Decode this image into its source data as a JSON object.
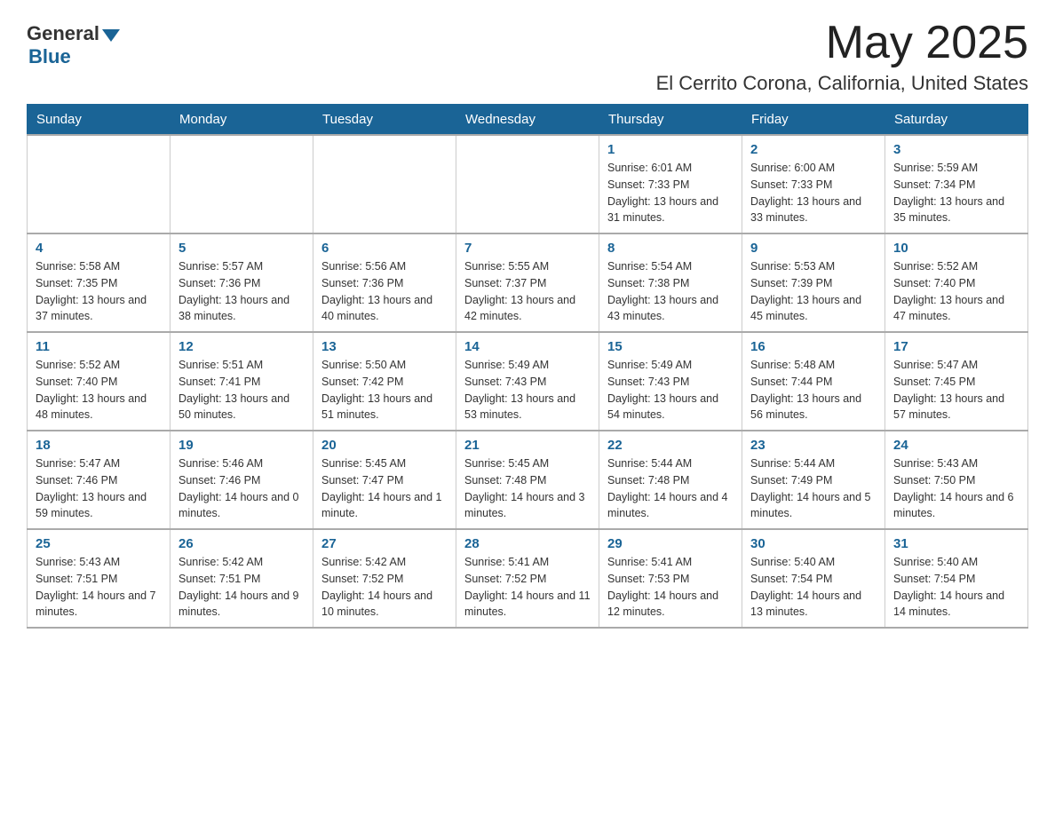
{
  "header": {
    "logo_general": "General",
    "logo_blue": "Blue",
    "month_title": "May 2025",
    "location": "El Cerrito Corona, California, United States"
  },
  "days_of_week": [
    "Sunday",
    "Monday",
    "Tuesday",
    "Wednesday",
    "Thursday",
    "Friday",
    "Saturday"
  ],
  "weeks": [
    [
      {
        "day": "",
        "sunrise": "",
        "sunset": "",
        "daylight": ""
      },
      {
        "day": "",
        "sunrise": "",
        "sunset": "",
        "daylight": ""
      },
      {
        "day": "",
        "sunrise": "",
        "sunset": "",
        "daylight": ""
      },
      {
        "day": "",
        "sunrise": "",
        "sunset": "",
        "daylight": ""
      },
      {
        "day": "1",
        "sunrise": "Sunrise: 6:01 AM",
        "sunset": "Sunset: 7:33 PM",
        "daylight": "Daylight: 13 hours and 31 minutes."
      },
      {
        "day": "2",
        "sunrise": "Sunrise: 6:00 AM",
        "sunset": "Sunset: 7:33 PM",
        "daylight": "Daylight: 13 hours and 33 minutes."
      },
      {
        "day": "3",
        "sunrise": "Sunrise: 5:59 AM",
        "sunset": "Sunset: 7:34 PM",
        "daylight": "Daylight: 13 hours and 35 minutes."
      }
    ],
    [
      {
        "day": "4",
        "sunrise": "Sunrise: 5:58 AM",
        "sunset": "Sunset: 7:35 PM",
        "daylight": "Daylight: 13 hours and 37 minutes."
      },
      {
        "day": "5",
        "sunrise": "Sunrise: 5:57 AM",
        "sunset": "Sunset: 7:36 PM",
        "daylight": "Daylight: 13 hours and 38 minutes."
      },
      {
        "day": "6",
        "sunrise": "Sunrise: 5:56 AM",
        "sunset": "Sunset: 7:36 PM",
        "daylight": "Daylight: 13 hours and 40 minutes."
      },
      {
        "day": "7",
        "sunrise": "Sunrise: 5:55 AM",
        "sunset": "Sunset: 7:37 PM",
        "daylight": "Daylight: 13 hours and 42 minutes."
      },
      {
        "day": "8",
        "sunrise": "Sunrise: 5:54 AM",
        "sunset": "Sunset: 7:38 PM",
        "daylight": "Daylight: 13 hours and 43 minutes."
      },
      {
        "day": "9",
        "sunrise": "Sunrise: 5:53 AM",
        "sunset": "Sunset: 7:39 PM",
        "daylight": "Daylight: 13 hours and 45 minutes."
      },
      {
        "day": "10",
        "sunrise": "Sunrise: 5:52 AM",
        "sunset": "Sunset: 7:40 PM",
        "daylight": "Daylight: 13 hours and 47 minutes."
      }
    ],
    [
      {
        "day": "11",
        "sunrise": "Sunrise: 5:52 AM",
        "sunset": "Sunset: 7:40 PM",
        "daylight": "Daylight: 13 hours and 48 minutes."
      },
      {
        "day": "12",
        "sunrise": "Sunrise: 5:51 AM",
        "sunset": "Sunset: 7:41 PM",
        "daylight": "Daylight: 13 hours and 50 minutes."
      },
      {
        "day": "13",
        "sunrise": "Sunrise: 5:50 AM",
        "sunset": "Sunset: 7:42 PM",
        "daylight": "Daylight: 13 hours and 51 minutes."
      },
      {
        "day": "14",
        "sunrise": "Sunrise: 5:49 AM",
        "sunset": "Sunset: 7:43 PM",
        "daylight": "Daylight: 13 hours and 53 minutes."
      },
      {
        "day": "15",
        "sunrise": "Sunrise: 5:49 AM",
        "sunset": "Sunset: 7:43 PM",
        "daylight": "Daylight: 13 hours and 54 minutes."
      },
      {
        "day": "16",
        "sunrise": "Sunrise: 5:48 AM",
        "sunset": "Sunset: 7:44 PM",
        "daylight": "Daylight: 13 hours and 56 minutes."
      },
      {
        "day": "17",
        "sunrise": "Sunrise: 5:47 AM",
        "sunset": "Sunset: 7:45 PM",
        "daylight": "Daylight: 13 hours and 57 minutes."
      }
    ],
    [
      {
        "day": "18",
        "sunrise": "Sunrise: 5:47 AM",
        "sunset": "Sunset: 7:46 PM",
        "daylight": "Daylight: 13 hours and 59 minutes."
      },
      {
        "day": "19",
        "sunrise": "Sunrise: 5:46 AM",
        "sunset": "Sunset: 7:46 PM",
        "daylight": "Daylight: 14 hours and 0 minutes."
      },
      {
        "day": "20",
        "sunrise": "Sunrise: 5:45 AM",
        "sunset": "Sunset: 7:47 PM",
        "daylight": "Daylight: 14 hours and 1 minute."
      },
      {
        "day": "21",
        "sunrise": "Sunrise: 5:45 AM",
        "sunset": "Sunset: 7:48 PM",
        "daylight": "Daylight: 14 hours and 3 minutes."
      },
      {
        "day": "22",
        "sunrise": "Sunrise: 5:44 AM",
        "sunset": "Sunset: 7:48 PM",
        "daylight": "Daylight: 14 hours and 4 minutes."
      },
      {
        "day": "23",
        "sunrise": "Sunrise: 5:44 AM",
        "sunset": "Sunset: 7:49 PM",
        "daylight": "Daylight: 14 hours and 5 minutes."
      },
      {
        "day": "24",
        "sunrise": "Sunrise: 5:43 AM",
        "sunset": "Sunset: 7:50 PM",
        "daylight": "Daylight: 14 hours and 6 minutes."
      }
    ],
    [
      {
        "day": "25",
        "sunrise": "Sunrise: 5:43 AM",
        "sunset": "Sunset: 7:51 PM",
        "daylight": "Daylight: 14 hours and 7 minutes."
      },
      {
        "day": "26",
        "sunrise": "Sunrise: 5:42 AM",
        "sunset": "Sunset: 7:51 PM",
        "daylight": "Daylight: 14 hours and 9 minutes."
      },
      {
        "day": "27",
        "sunrise": "Sunrise: 5:42 AM",
        "sunset": "Sunset: 7:52 PM",
        "daylight": "Daylight: 14 hours and 10 minutes."
      },
      {
        "day": "28",
        "sunrise": "Sunrise: 5:41 AM",
        "sunset": "Sunset: 7:52 PM",
        "daylight": "Daylight: 14 hours and 11 minutes."
      },
      {
        "day": "29",
        "sunrise": "Sunrise: 5:41 AM",
        "sunset": "Sunset: 7:53 PM",
        "daylight": "Daylight: 14 hours and 12 minutes."
      },
      {
        "day": "30",
        "sunrise": "Sunrise: 5:40 AM",
        "sunset": "Sunset: 7:54 PM",
        "daylight": "Daylight: 14 hours and 13 minutes."
      },
      {
        "day": "31",
        "sunrise": "Sunrise: 5:40 AM",
        "sunset": "Sunset: 7:54 PM",
        "daylight": "Daylight: 14 hours and 14 minutes."
      }
    ]
  ]
}
